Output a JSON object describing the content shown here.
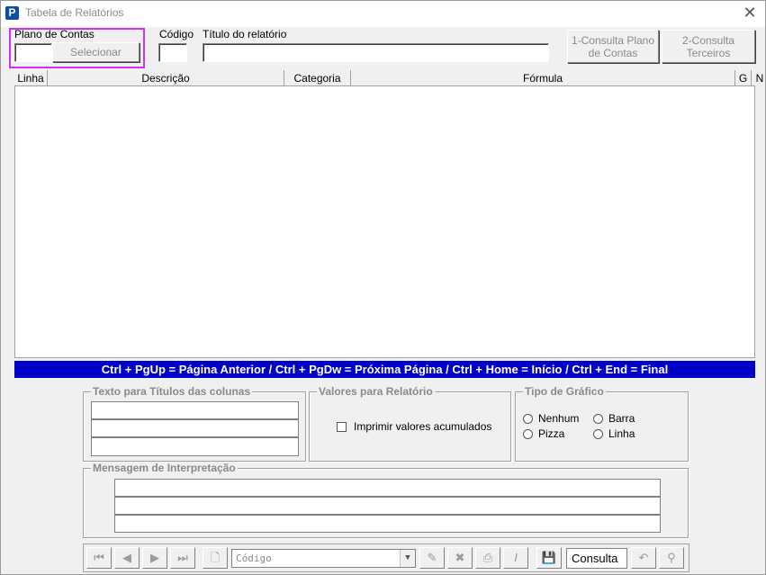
{
  "window": {
    "title": "Tabela de Relatórios",
    "close": "✕"
  },
  "header": {
    "plano_label": "Plano de Contas",
    "selecionar": "Selecionar",
    "codigo_label": "Código",
    "titulo_label": "Título do relatório",
    "btn_consulta_plano_line1": "1-Consulta Plano",
    "btn_consulta_plano_line2": "de Contas",
    "btn_consulta_terceiros_line1": "2-Consulta",
    "btn_consulta_terceiros_line2": "Terceiros"
  },
  "grid": {
    "columns": [
      "Linha",
      "Descrição",
      "Categoria",
      "Fórmula",
      "G",
      "N"
    ]
  },
  "hint": "Ctrl + PgUp = Página Anterior / Ctrl + PgDw = Próxima Página / Ctrl + Home = Início / Ctrl + End = Final",
  "texto_titulos": {
    "label": "Texto para Títulos das colunas"
  },
  "valores": {
    "label": "Valores para Relatório",
    "checkbox": "Imprimir valores acumulados"
  },
  "tipo_grafico": {
    "label": "Tipo de Gráfico",
    "options": [
      "Nenhum",
      "Barra",
      "Pizza",
      "Linha"
    ]
  },
  "mensagem": {
    "label": "Mensagem de Interpretação"
  },
  "toolbar": {
    "combo_value": "Código",
    "consulta": "Consulta"
  }
}
